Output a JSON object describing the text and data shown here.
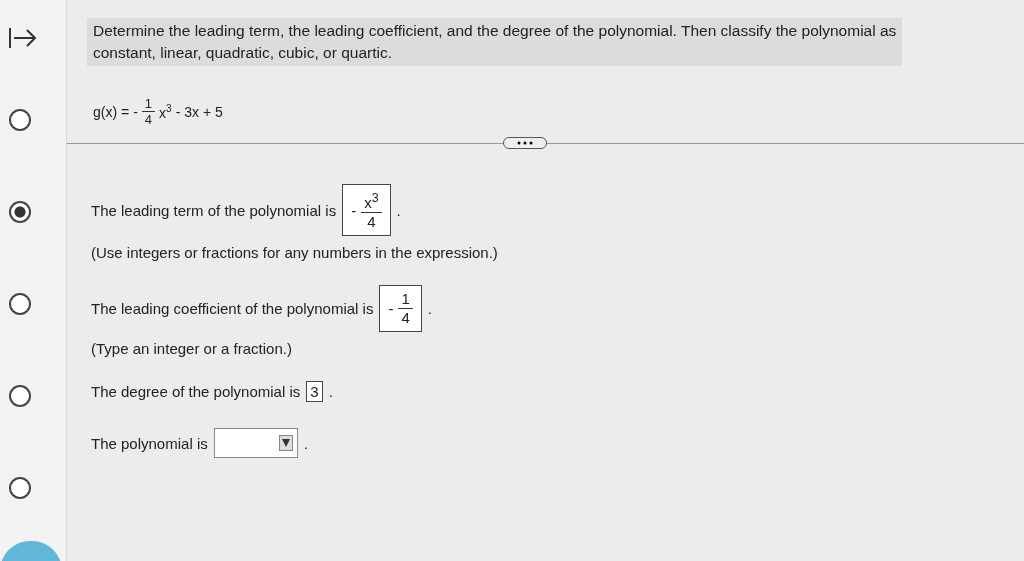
{
  "question": {
    "lines": [
      "Determine the leading term, the leading coefficient, and the degree of the polynomial. Then classify the polynomial as",
      "constant, linear, quadratic, cubic, or quartic."
    ]
  },
  "function": {
    "name": "g(x) =",
    "sign": "-",
    "numerator": "1",
    "denominator": "4",
    "base": "x",
    "exponent": "3",
    "rest": "- 3x + 5"
  },
  "choices": [
    {
      "selected": false
    },
    {
      "selected": true
    },
    {
      "selected": false
    },
    {
      "selected": false
    },
    {
      "selected": false
    }
  ],
  "answers": [
    {
      "kind": "fraction",
      "text": "The leading term of the polynomial is",
      "sign": "-",
      "numerator": "x$^{3}$",
      "denominator": "4",
      "end": ".",
      "note": "(Use integers or fractions for any numbers in the expression.)"
    },
    {
      "kind": "fraction",
      "text": "The leading coefficient of the polynomial is",
      "sign": "-",
      "numerator": "1",
      "denominator": "4",
      "end": ".",
      "note": "(Type an integer or a fraction.)"
    },
    {
      "kind": "plain",
      "text": "The degree of the polynomial is",
      "value": "3",
      "end": "."
    },
    {
      "kind": "dropdown",
      "text": "The polynomial is",
      "end": "."
    }
  ]
}
